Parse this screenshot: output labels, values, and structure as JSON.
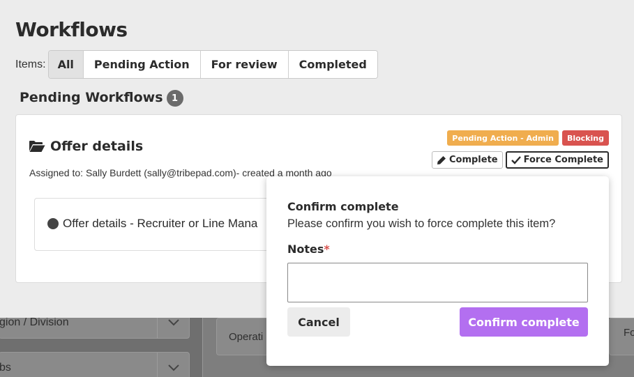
{
  "page": {
    "title": "Workflows"
  },
  "filters": {
    "label": "Items:",
    "tabs": [
      {
        "label": "All",
        "active": true
      },
      {
        "label": "Pending Action",
        "active": false
      },
      {
        "label": "For review",
        "active": false
      },
      {
        "label": "Completed",
        "active": false
      }
    ]
  },
  "section": {
    "title": "Pending Workflows",
    "count": "1"
  },
  "workflow_card": {
    "title": "Offer details",
    "folder_icon": "folder-open-icon",
    "assigned": "Assigned to: Sally Burdett (sally@tribepad.com)- created a month ago",
    "badges": [
      {
        "label": "Pending Action - Admin",
        "color": "#f0ad4e"
      },
      {
        "label": "Blocking",
        "color": "#d9534f"
      }
    ],
    "actions": {
      "complete_label": "Complete",
      "complete_icon": "pencil-icon",
      "force_complete_label": "Force Complete",
      "force_complete_icon": "check-icon"
    },
    "step": {
      "label": "Offer details - Recruiter or Line Mana"
    }
  },
  "popover": {
    "title": "Confirm complete",
    "message": "Please confirm you wish to force complete this item?",
    "notes_label": "Notes",
    "required_mark": "*",
    "notes_value": "",
    "cancel_label": "Cancel",
    "confirm_label": "Confirm complete",
    "confirm_color": "#b36ff0"
  },
  "background": {
    "field1_label": "gion / Division",
    "field2_label": "bs",
    "panel1_text": "Operati",
    "panel2_text": "Fo"
  }
}
